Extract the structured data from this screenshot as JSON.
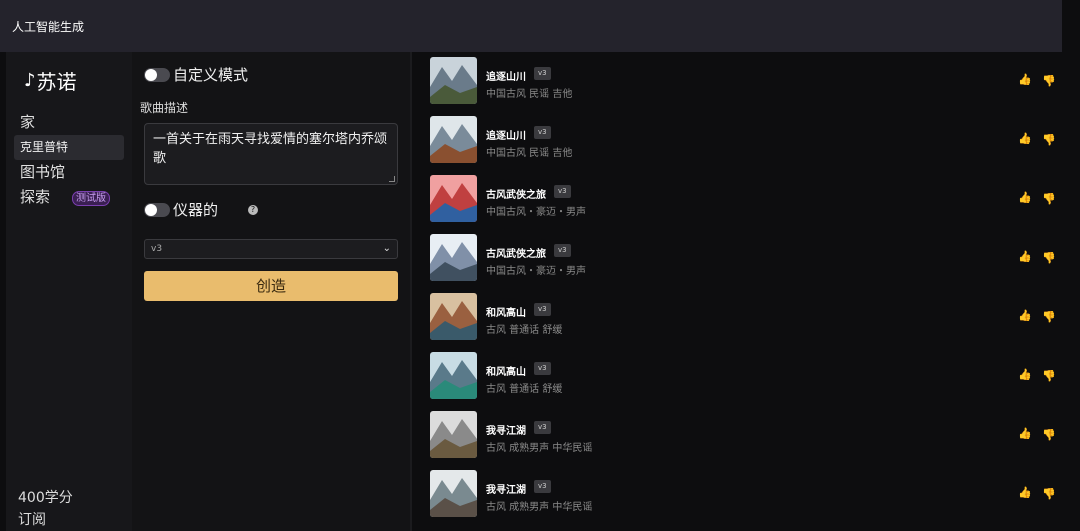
{
  "topbar": {
    "label": "人工智能生成"
  },
  "sidebar": {
    "logo": "苏诺",
    "items": [
      {
        "label": "家"
      },
      {
        "label": "克里普特"
      },
      {
        "label": "图书馆"
      },
      {
        "label": "探索",
        "badge": "测试版"
      }
    ],
    "credits": "400学分",
    "subscribe": "订阅"
  },
  "form": {
    "custom_mode_label": "自定义模式",
    "description_label": "歌曲描述",
    "description_value": "一首关于在雨天寻找爱情的塞尔塔内乔颂歌",
    "instrumental_label": "仪器的",
    "version_selected": "v3",
    "create_label": "创造"
  },
  "songs": [
    {
      "title": "追逐山川",
      "version": "v3",
      "tags": "中国古风 民谣 吉他",
      "colors": [
        "#6a7b8a",
        "#c9d3da",
        "#4a5a3a"
      ]
    },
    {
      "title": "追逐山川",
      "version": "v3",
      "tags": "中国古风 民谣 吉他",
      "colors": [
        "#7a8b9a",
        "#dfe6ea",
        "#8a5030"
      ]
    },
    {
      "title": "古风武侠之旅",
      "version": "v3",
      "tags": "中国古风・豪迈・男声",
      "colors": [
        "#c04040",
        "#f0a0a0",
        "#3060a0"
      ]
    },
    {
      "title": "古风武侠之旅",
      "version": "v3",
      "tags": "中国古风・豪迈・男声",
      "colors": [
        "#8090a8",
        "#e8eef4",
        "#405060"
      ]
    },
    {
      "title": "和风高山",
      "version": "v3",
      "tags": "古风 普通话 舒缓",
      "colors": [
        "#9a6040",
        "#d8c0a0",
        "#3a5a6a"
      ]
    },
    {
      "title": "和风高山",
      "version": "v3",
      "tags": "古风 普通话 舒缓",
      "colors": [
        "#5a7a8a",
        "#c8dce4",
        "#2a8a7a"
      ]
    },
    {
      "title": "我寻江湖",
      "version": "v3",
      "tags": "古风 成熟男声 中华民谣",
      "colors": [
        "#8a8a8a",
        "#dcdcdc",
        "#6a5a40"
      ]
    },
    {
      "title": "我寻江湖",
      "version": "v3",
      "tags": "古风 成熟男声 中华民谣",
      "colors": [
        "#7a8a90",
        "#e4e8ea",
        "#5a5048"
      ]
    }
  ],
  "icons": {
    "logo": "music-note-icon",
    "help": "help-circle-icon",
    "dropdown": "chevron-down-icon",
    "like": "thumbs-up-icon",
    "dislike": "thumbs-down-icon"
  }
}
